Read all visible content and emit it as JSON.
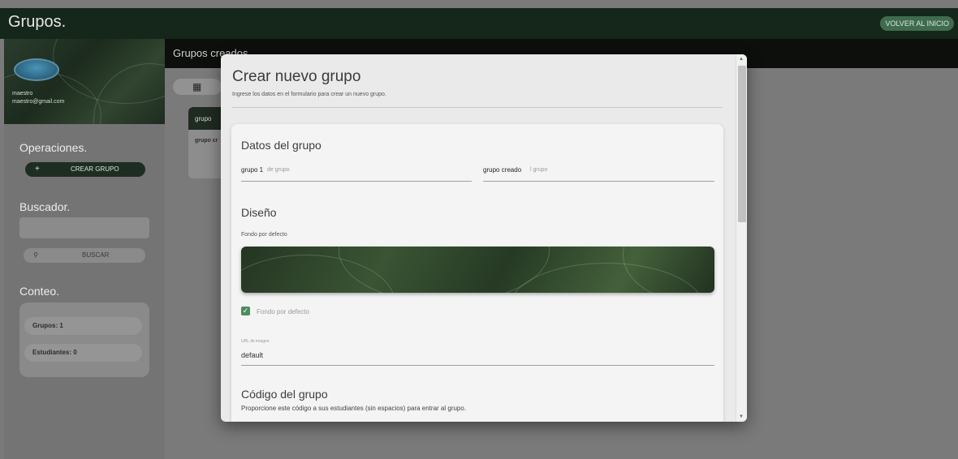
{
  "topbar": {
    "title": "Grupos.",
    "back_label": "VOLVER AL INICIO"
  },
  "sidebar": {
    "profile": {
      "name": "maestro",
      "email": "maestro@gmail.com"
    },
    "operations_title": "Operaciones.",
    "create_button": {
      "icon": "+",
      "label": "CREAR GRUPO"
    },
    "search_title": "Buscador.",
    "search_input_value": "",
    "search_button": {
      "icon": "search-icon",
      "label": "BUSCAR"
    },
    "count_title": "Conteo.",
    "counts": {
      "groups": "Grupos: 1",
      "students": "Estudiantes: 0"
    }
  },
  "main": {
    "header_title": "Grupos creados",
    "view_toggle_icon": "grid-icon",
    "card": {
      "name": "grupo",
      "desc": "grupo cr"
    }
  },
  "modal": {
    "title": "Crear nuevo grupo",
    "subtitle": "Ingrese los datos en el formulario para crear un nuevo grupo.",
    "group_data_title": "Datos del grupo",
    "name_field": {
      "value": "grupo 1",
      "placeholder": "de grupo"
    },
    "desc_field": {
      "value": "grupo creado",
      "placeholder": "l grupo"
    },
    "design_title": "Diseño",
    "default_bg_label": "Fondo por defecto",
    "checkbox_label": "Fondo por defecto",
    "checkbox_checked": true,
    "url_label": "URL de imagen",
    "url_value": "default",
    "code_title": "Código del grupo",
    "code_desc": "Proporcione este código a sus estudiantes (sin espacios) para entrar al grupo."
  },
  "colors": {
    "topbar": "#15261b",
    "accent": "#4f8a5e",
    "button_dark": "#1e2d22"
  }
}
